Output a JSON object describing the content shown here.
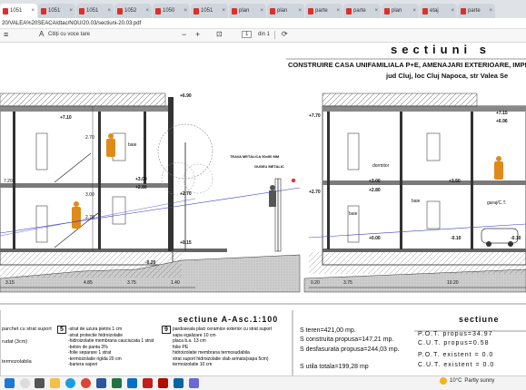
{
  "browser": {
    "tabs": [
      {
        "label": "1051"
      },
      {
        "label": "1051"
      },
      {
        "label": "1051"
      },
      {
        "label": "1052"
      },
      {
        "label": "1050"
      },
      {
        "label": "1051"
      },
      {
        "label": "plan"
      },
      {
        "label": "plan"
      },
      {
        "label": "parte"
      },
      {
        "label": "parte"
      },
      {
        "label": "plan"
      },
      {
        "label": "etaj"
      },
      {
        "label": "parte"
      }
    ],
    "address": "20/VALEA%20SEACA/dtac/NOU/20.03/sectiuni-20.03.pdf"
  },
  "pdf_toolbar": {
    "read_aloud": "Citiți cu voce tare",
    "page_number": "1",
    "page_total": "din 1"
  },
  "sheet": {
    "title": "sectiuni s",
    "project": "CONSTRUIRE CASA UNIFAMILIALA P+E, AMENAJARI EXTERIOARE, IMPREJM",
    "location": "jud Cluj, loc Cluj Napoca, str Valea Se",
    "section_label_a": "sectiune A-Asc.1:100",
    "section_label_b": "sectiune",
    "fence_labels": [
      "TEAVA METALICA 50x50 MM",
      "GUSEU METALIC"
    ],
    "room_labels": [
      "baie",
      "dormitor",
      "baie",
      "baie",
      "garaj/C.T."
    ],
    "levels_left": [
      "+6.90",
      "+7.10",
      "+3.00",
      "+2.80",
      "+2.70",
      "+0.15",
      "-0.20"
    ],
    "levels_right": [
      "+7.70",
      "+7.15",
      "+6.96",
      "+3.00",
      "+2.80",
      "+2.70",
      "+3.50",
      "+0.00",
      "-0.10",
      "-0.10"
    ],
    "dims_bottom_left": [
      "3.15",
      "4.85",
      "3.75",
      "1.40"
    ],
    "dims_bottom_right": [
      "0.20",
      "3.75",
      "10.20"
    ],
    "dims_vertical": [
      "2.70",
      "2.70",
      "3.00",
      "7.20"
    ],
    "legend": {
      "col1_title": "parchet cu strat suport",
      "col1_items": [
        "rudat (3cm)",
        "termozolabila"
      ],
      "item5_no": "5",
      "item5_lines": [
        "-strat de uzura pietris 1 cm",
        "-strat protectie hidroizolatie",
        "-hidroizolatie membrana cauciucata 1 strat",
        "-beton de panta 3%",
        "-folie separare 1 strat",
        "-termoizolatie rigida 20 cm",
        "-bariera vapori"
      ],
      "item9_no": "9",
      "item9_lines": [
        "pardoseala placi ceramice exterior cu strat suport",
        "sapa egalizare 10 cm",
        "placa b.a. 13 cm",
        "folie PE",
        "hidroizolatie membrana termosudabila",
        "strat suport hidroizolatie slab armata(sapa 5cm)",
        "termoizolatie 10 cm"
      ]
    },
    "areas": [
      {
        "label": "S teren=421,00 mp."
      },
      {
        "label": "S construita propusa=147,21 mp."
      },
      {
        "label": "S desfasurata propusa=244,03 mp."
      },
      {
        "label": "S utila totala=199,28 mp"
      }
    ],
    "indicators": [
      "P.O.T. propus=34.97",
      "C.U.T. propus=0.58",
      "P.O.T. existent = 0.0",
      "C.U.T. existent = 0.0"
    ]
  },
  "taskbar": {
    "weather_temp": "10°C",
    "weather_text": "Partly sunny"
  }
}
